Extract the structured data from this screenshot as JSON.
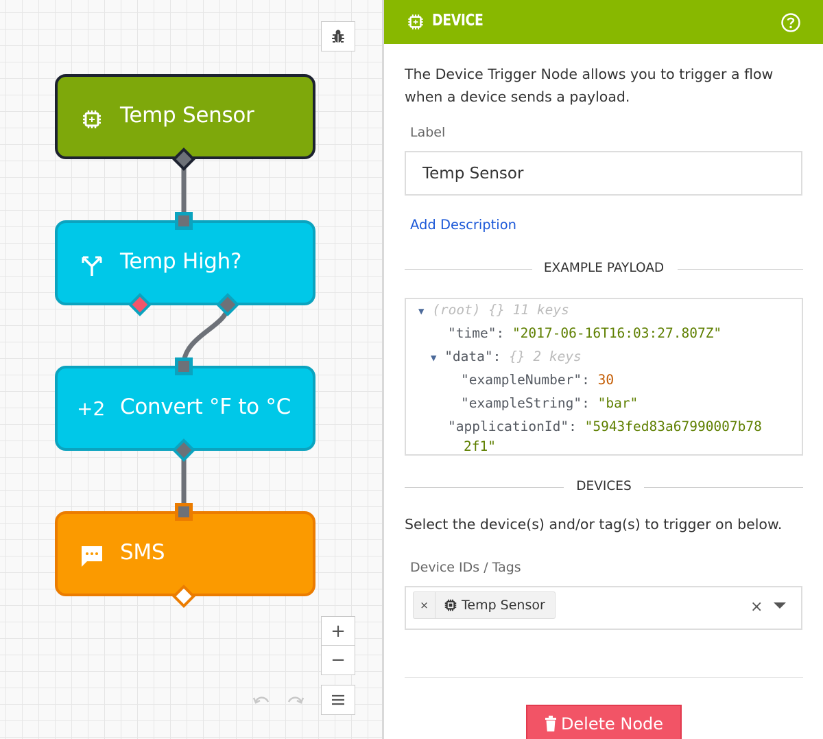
{
  "canvas": {
    "nodes": {
      "trigger": {
        "label": "Temp Sensor",
        "icon": "chip-icon",
        "color": "#7ea80b"
      },
      "conditional": {
        "label": "Temp High?",
        "icon": "split-icon",
        "color": "#00c8e8"
      },
      "function": {
        "label": "Convert °F to °C",
        "badge": "+2",
        "color": "#00c8e8"
      },
      "sms": {
        "label": "SMS",
        "icon": "chat-icon",
        "color": "#fb9a00"
      }
    },
    "toolbar": {
      "zoom_in": "+",
      "zoom_out": "−"
    }
  },
  "panel": {
    "title": "DEVICE",
    "header_color": "#88b800",
    "description": "The Device Trigger Node allows you to trigger a flow when a device sends a payload.",
    "label_caption": "Label",
    "label_value": "Temp Sensor",
    "add_description": "Add Description",
    "example_payload_title": "EXAMPLE PAYLOAD",
    "payload": {
      "root_label": "(root)",
      "root_braces": "{}",
      "root_keys": "11 keys",
      "time_key": "\"time\"",
      "time_value": "\"2017-06-16T16:03:27.807Z\"",
      "data_key": "\"data\"",
      "data_braces": "{}",
      "data_keys": "2 keys",
      "number_key": "\"exampleNumber\"",
      "number_value": "30",
      "string_key": "\"exampleString\"",
      "string_value": "\"bar\"",
      "app_key": "\"applicationId\"",
      "app_value_line1": "\"5943fed83a67990007b78",
      "app_value_line2": "2f1\""
    },
    "devices_title": "DEVICES",
    "devices_description": "Select the device(s) and/or tag(s) to trigger on below.",
    "ids_caption": "Device IDs / Tags",
    "selected_tag": "Temp Sensor",
    "tag_remove": "×",
    "clear_all": "×",
    "delete_label": "Delete Node",
    "delete_color": "#f25466"
  }
}
